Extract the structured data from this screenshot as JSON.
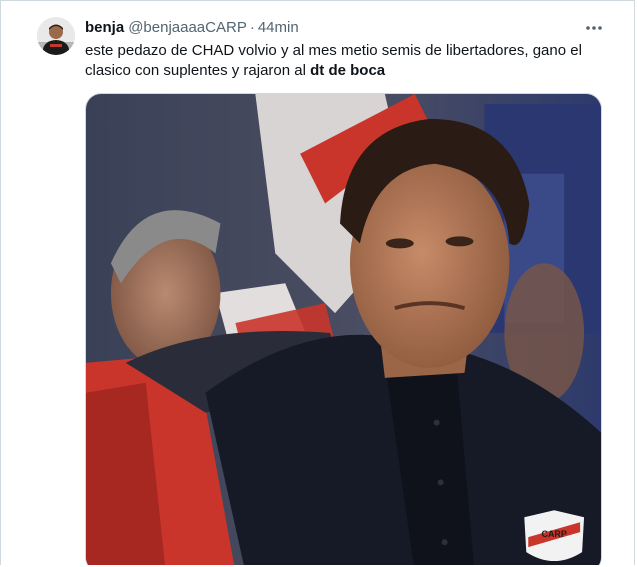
{
  "tweet": {
    "display_name": "benja",
    "handle": "@benjaaaaCARP",
    "separator": "·",
    "time": "44min",
    "text_main": "este pedazo de CHAD volvio y al mes metio semis de libertadores, gano el clasico con suplentes y rajaron al ",
    "text_bold": "dt de boca"
  },
  "icons": {
    "more": "more-horizontal-icon",
    "badge": "river-plate-crest-icon"
  },
  "media": {
    "badge_text": "CARP"
  },
  "colors": {
    "secondary_text": "#536471",
    "border": "#cfd9de",
    "jersey_red": "#c9352b",
    "suit": "#161a26"
  }
}
